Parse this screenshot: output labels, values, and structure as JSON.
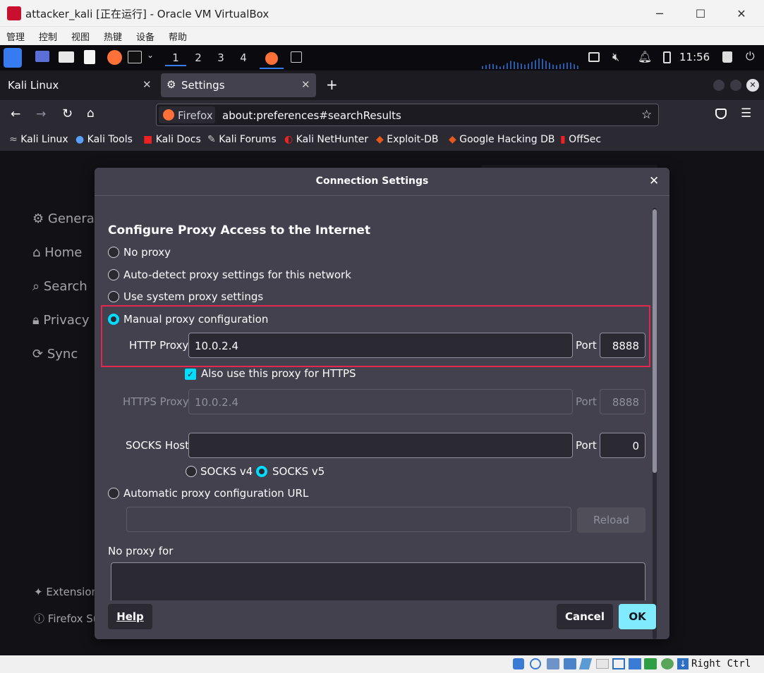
{
  "vbox": {
    "title": "attacker_kali [正在运行] - Oracle VM VirtualBox",
    "menu": [
      "管理",
      "控制",
      "视图",
      "热键",
      "设备",
      "帮助"
    ],
    "host_key": "Right Ctrl"
  },
  "panel": {
    "workspaces": [
      "1",
      "2",
      "3",
      "4"
    ],
    "clock": "11:56"
  },
  "browser": {
    "tabs": [
      {
        "label": "Kali Linux"
      },
      {
        "label": "Settings"
      }
    ],
    "url_identity": "Firefox",
    "url": "about:preferences#searchResults",
    "bookmarks": [
      "Kali Linux",
      "Kali Tools",
      "Kali Docs",
      "Kali Forums",
      "Kali NetHunter",
      "Exploit-DB",
      "Google Hacking DB",
      "OffSec"
    ]
  },
  "settings_sidebar": {
    "items": [
      "General",
      "Home",
      "Search",
      "Privacy",
      "Sync"
    ],
    "bottom": [
      "Extensions",
      "Firefox Support"
    ]
  },
  "dialog": {
    "title": "Connection Settings",
    "heading": "Configure Proxy Access to the Internet",
    "options": {
      "no_proxy": "No proxy",
      "auto_detect": "Auto-detect proxy settings for this network",
      "system": "Use system proxy settings",
      "manual": "Manual proxy configuration",
      "pac": "Automatic proxy configuration URL"
    },
    "selected": "manual",
    "http_proxy_label": "HTTP Proxy",
    "http_proxy": "10.0.2.4",
    "port_label": "Port",
    "http_port": "8888",
    "also_https_label": "Also use this proxy for HTTPS",
    "also_https": true,
    "https_proxy_label": "HTTPS Proxy",
    "https_proxy": "10.0.2.4",
    "https_port": "8888",
    "socks_label": "SOCKS Host",
    "socks_host": "",
    "socks_port": "0",
    "socks_v4": "SOCKS v4",
    "socks_v5": "SOCKS v5",
    "socks_selected": "v5",
    "pac_url": "",
    "reload": "Reload",
    "no_proxy_for_label": "No proxy for",
    "no_proxy_for": "",
    "help": "Help",
    "cancel": "Cancel",
    "ok": "OK",
    "highlight_color": "#e22850",
    "accent": "#00ddff"
  }
}
